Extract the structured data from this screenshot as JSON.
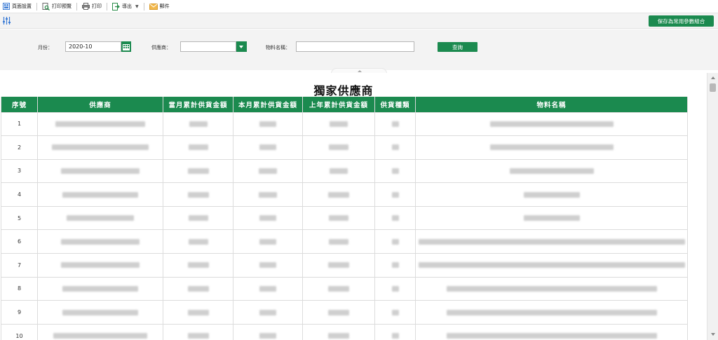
{
  "toolbar": {
    "page_setup": "頁面設置",
    "print_preview": "打印預覽",
    "print": "打印",
    "export": "導出",
    "mail": "郵件"
  },
  "params": {
    "save_label": "保存為常用參數組合"
  },
  "form": {
    "month_label": "月份：",
    "month_value": "2020-10",
    "supplier_label": "供應商：",
    "supplier_value": "",
    "material_label": "物料名稱：",
    "material_value": "",
    "query_label": "查詢"
  },
  "report": {
    "title": "獨家供應商",
    "columns": [
      "序號",
      "供應商",
      "當月累計供貨金額",
      "本月累計供貨金額",
      "上年累計供貨金額",
      "供貨種類",
      "物料名稱"
    ],
    "rows": [
      {
        "index": "1"
      },
      {
        "index": "2"
      },
      {
        "index": "3"
      },
      {
        "index": "4"
      },
      {
        "index": "5"
      },
      {
        "index": "6"
      },
      {
        "index": "7"
      },
      {
        "index": "8"
      },
      {
        "index": "9"
      },
      {
        "index": "10"
      }
    ]
  },
  "colors": {
    "accent": "#1b8a4f",
    "header_text": "#ffffff"
  },
  "icons": [
    "page-setup-icon",
    "print-preview-icon",
    "print-icon",
    "export-icon",
    "mail-icon",
    "parameter-settings-icon",
    "calendar-icon",
    "dropdown-arrow-icon"
  ]
}
